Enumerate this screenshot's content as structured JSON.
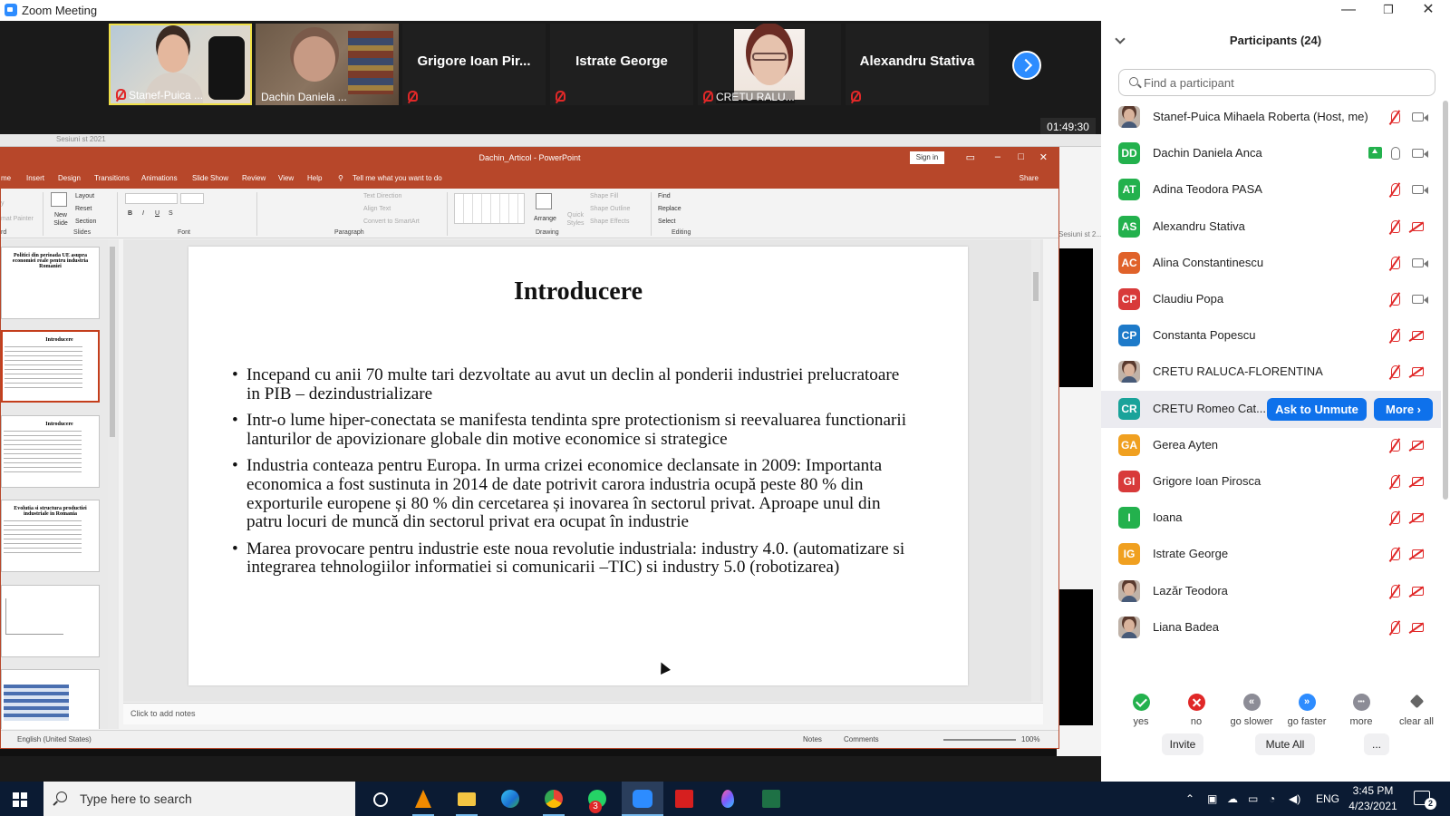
{
  "window": {
    "title": "Zoom Meeting",
    "minimize": "—",
    "restore": "❐",
    "close": "✕"
  },
  "video_strip": {
    "tiles": [
      {
        "label": "Stanef-Puica ..."
      },
      {
        "label": "Dachin Daniela ..."
      },
      {
        "name": "Grigore Ioan Pir..."
      },
      {
        "name": "Istrate George"
      },
      {
        "label": "CRETU RALU..."
      },
      {
        "name": "Alexandru Stativa"
      }
    ],
    "timer": "01:49:30"
  },
  "share": {
    "bg_window_tab": "Sesiuni st 2021",
    "bg_right_tag": "Sesiuni st 2...",
    "ppt": {
      "doc_title": "Dachin_Articol - PowerPoint",
      "sign_in": "Sign in",
      "share": "Share",
      "tabs": [
        "me",
        "Insert",
        "Design",
        "Transitions",
        "Animations",
        "Slide Show",
        "Review",
        "View",
        "Help",
        "Tell me what you want to do"
      ],
      "ribbon": {
        "format_painter": "mat Painter",
        "clipboard": "rd",
        "new_slide": "New Slide",
        "layout": "Layout",
        "reset": "Reset",
        "section": "Section",
        "slides": "Slides",
        "font": "Font",
        "paragraph": "Paragraph",
        "text_direction": "Text Direction",
        "align_text": "Align Text",
        "convert_smartart": "Convert to SmartArt",
        "arrange": "Arrange",
        "quick_styles": "Quick Styles",
        "shape_fill": "Shape Fill",
        "shape_outline": "Shape Outline",
        "shape_effects": "Shape Effects",
        "drawing": "Drawing",
        "find": "Find",
        "replace": "Replace",
        "select": "Select",
        "editing": "Editing"
      },
      "thumbnails": [
        {
          "title": "Politici din perioada UE asupra economiei reale pentru industria Romaniei"
        },
        {
          "title": "Introducere"
        },
        {
          "title": "Introducere"
        },
        {
          "title": "Evolutia si structura productiei industriale in Romania"
        },
        {
          "title": ""
        },
        {
          "title": ""
        }
      ],
      "slide": {
        "title": "Introducere",
        "bullets": [
          "Incepand cu anii 70 multe tari dezvoltate au avut un declin al ponderii industriei prelucratoare in PIB – dezindustrializare",
          "Intr-o lume hiper-conectata  se manifesta tendinta spre protectionism si reevaluarea functionarii lanturilor de apovizionare globale din motive economice si strategice",
          " Industria conteaza pentru Europa. In urma crizei economice declansate in 2009: Importanta economica a fost sustinuta in 2014 de date potrivit carora industria ocupă peste 80 % din exporturile europene și 80 % din cercetarea și inovarea în sectorul privat. Aproape unul din patru locuri de muncă din sectorul privat era ocupat în industrie",
          "Marea provocare pentru industrie este noua revolutie industriala: industry 4.0. (automatizare si  integrarea tehnologiilor informatiei si comunicarii –TIC) si industry 5.0 (robotizarea)"
        ]
      },
      "notes_placeholder": "Click to add notes",
      "status": {
        "language": "English (United States)",
        "notes": "Notes",
        "comments": "Comments",
        "zoom": "100%"
      }
    }
  },
  "participants": {
    "header": "Participants (24)",
    "search_placeholder": "Find a participant",
    "list": [
      {
        "initials": "",
        "name": "Stanef-Puica Mihaela Roberta (Host, me)",
        "color": "#bfb2a8",
        "photo": true,
        "mic": "off",
        "cam": "on"
      },
      {
        "initials": "DD",
        "name": "Dachin Daniela Anca",
        "color": "#23b14d",
        "photo": false,
        "mic": "on",
        "cam": "on",
        "sharing": true
      },
      {
        "initials": "AT",
        "name": "Adina Teodora PASA",
        "color": "#23b14d",
        "photo": false,
        "mic": "off",
        "cam": "on"
      },
      {
        "initials": "AS",
        "name": "Alexandru Stativa",
        "color": "#23b14d",
        "photo": false,
        "mic": "off",
        "cam": "off"
      },
      {
        "initials": "AC",
        "name": "Alina Constantinescu",
        "color": "#e0622a",
        "photo": false,
        "mic": "off",
        "cam": "on"
      },
      {
        "initials": "CP",
        "name": "Claudiu Popa",
        "color": "#d83a3a",
        "photo": false,
        "mic": "off",
        "cam": "on"
      },
      {
        "initials": "CP",
        "name": "Constanta Popescu",
        "color": "#1d7ac9",
        "photo": false,
        "mic": "off",
        "cam": "off"
      },
      {
        "initials": "",
        "name": "CRETU RALUCA-FLORENTINA",
        "color": "#bfb2a8",
        "photo": true,
        "mic": "off",
        "cam": "off"
      },
      {
        "initials": "CR",
        "name": "CRETU Romeo Cat...",
        "color": "#1aa39a",
        "photo": false,
        "hover": true
      },
      {
        "initials": "GA",
        "name": "Gerea Ayten",
        "color": "#f0a020",
        "photo": false,
        "mic": "off",
        "cam": "off"
      },
      {
        "initials": "GI",
        "name": "Grigore Ioan Pirosca",
        "color": "#d83a3a",
        "photo": false,
        "mic": "off",
        "cam": "off"
      },
      {
        "initials": "I",
        "name": "Ioana",
        "color": "#23b14d",
        "photo": false,
        "mic": "off",
        "cam": "off"
      },
      {
        "initials": "IG",
        "name": "Istrate George",
        "color": "#f0a020",
        "photo": false,
        "mic": "off",
        "cam": "off"
      },
      {
        "initials": "",
        "name": "Lazăr Teodora",
        "color": "#bfb2a8",
        "photo": true,
        "mic": "off",
        "cam": "off"
      },
      {
        "initials": "",
        "name": "Liana Badea",
        "color": "#bfb2a8",
        "photo": true,
        "mic": "off",
        "cam": "off"
      }
    ],
    "ask_to_unmute": "Ask to Unmute",
    "more": "More ›",
    "feedback": [
      {
        "label": "yes"
      },
      {
        "label": "no"
      },
      {
        "label": "go slower",
        "glyph": "«"
      },
      {
        "label": "go faster",
        "glyph": "»"
      },
      {
        "label": "more",
        "glyph": "•••"
      },
      {
        "label": "clear all"
      }
    ],
    "invite": "Invite",
    "mute_all": "Mute All",
    "overflow": "..."
  },
  "taskbar": {
    "search_placeholder": "Type here to search",
    "whatsapp_badge": "3",
    "language": "ENG",
    "time": "3:45 PM",
    "date": "4/23/2021",
    "notifications": "2"
  }
}
